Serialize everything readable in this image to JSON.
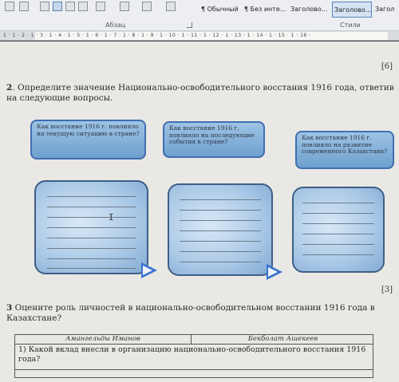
{
  "ribbon": {
    "styles": [
      {
        "label": "¶ Обычный",
        "selected": false
      },
      {
        "label": "¶ Без инте...",
        "selected": false
      },
      {
        "label": "Заголово...",
        "selected": false
      },
      {
        "label": "Заголово...",
        "selected": true
      },
      {
        "label": "Загол",
        "selected": false
      }
    ],
    "paragraph_group_label": "Абзац",
    "styles_group_label": "Стили"
  },
  "ruler": {
    "numbers": "1 · 1 · 2 · 1 · 3 · 1 · 4 · 1 · 5 · 1 · 6 · 1 · 7 · 1 · 8 · 1 · 9 · 1 · 10 · 1 · 11 · 1 · 12 · 1 · 13 · 1 · 14 · 1 · 15 · 1 · 16 ·"
  },
  "document": {
    "score_top": "[6]",
    "q2_number": "2",
    "q2_text": "Определите значение Национально-освободительного восстания 1916 года, ответив на следующие вопросы.",
    "question_boxes": [
      "Как восстание 1916 г. повлияло на текущую ситуацию в стране?",
      "Как восстание 1916 г. повлияло на последующие события в стране?",
      "Как восстание 1916 г. повлияло на развитие современного Казахстана?"
    ],
    "answer_line_count": 8,
    "score_q2": "[3]",
    "q3_number": "3",
    "q3_text": "Оцените роль личностей в национально-освободительном восстании 1916 года в Казахстане?",
    "table": {
      "headers": [
        "Амангельды Иманов",
        "Бекболат Ашекеев"
      ],
      "row1": "1) Какой вклад внесли в организацию национально-освободительного восстания 1916 года?"
    }
  }
}
